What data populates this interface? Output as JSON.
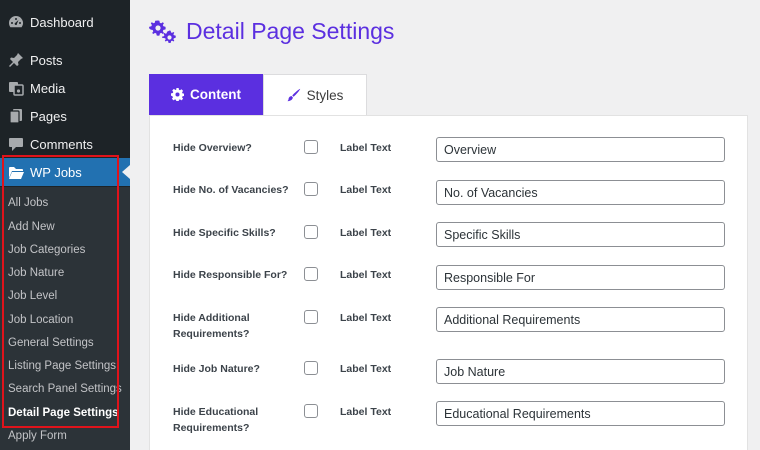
{
  "sidebar": {
    "menu": [
      {
        "label": "Dashboard",
        "icon": "dashboard-icon"
      },
      {
        "label": "Posts",
        "icon": "pin-icon"
      },
      {
        "label": "Media",
        "icon": "media-icon"
      },
      {
        "label": "Pages",
        "icon": "pages-icon"
      },
      {
        "label": "Comments",
        "icon": "comment-icon"
      },
      {
        "label": "WP Jobs",
        "icon": "folder-icon"
      }
    ],
    "submenu": [
      "All Jobs",
      "Add New",
      "Job Categories",
      "Job Nature",
      "Job Level",
      "Job Location",
      "General Settings",
      "Listing Page Settings",
      "Search Panel Settings",
      "Detail Page Settings",
      "Apply Form"
    ]
  },
  "header": {
    "title": "Detail Page Settings",
    "icon": "gears-icon"
  },
  "tabs": [
    {
      "label": "Content",
      "icon": "gear-icon"
    },
    {
      "label": "Styles",
      "icon": "brush-icon"
    }
  ],
  "form": {
    "label_text": "Label Text",
    "rows": [
      {
        "label": "Hide Overview?",
        "value": "Overview"
      },
      {
        "label": "Hide No. of Vacancies?",
        "value": "No. of Vacancies"
      },
      {
        "label": "Hide Specific Skills?",
        "value": "Specific Skills"
      },
      {
        "label": "Hide Responsible For?",
        "value": "Responsible For"
      },
      {
        "label": "Hide Additional Requirements?",
        "value": "Additional Requirements"
      },
      {
        "label": "Hide Job Nature?",
        "value": "Job Nature"
      },
      {
        "label": "Hide Educational Requirements?",
        "value": "Educational Requirements"
      }
    ]
  },
  "colors": {
    "accent": "#5b2fe0",
    "sidebar": "#1d2327",
    "active_menu": "#2271b1",
    "highlight": "#e0131b"
  }
}
